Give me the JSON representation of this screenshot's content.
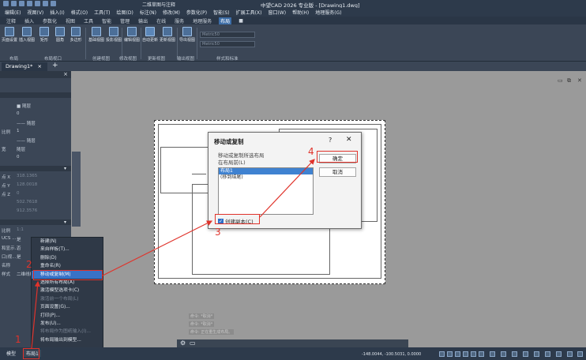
{
  "titlebar": {
    "title": "中望CAD 2026 专业版 - [Drawing1.dwg]",
    "workspace": "二维草图与注释"
  },
  "menu": [
    "编辑(E)",
    "视图(V)",
    "插入(I)",
    "格式(O)",
    "工具(T)",
    "绘图(D)",
    "标注(N)",
    "修改(M)",
    "参数化(P)",
    "智能(S)",
    "扩展工具(X)",
    "窗口(W)",
    "帮助(H)",
    "地理服务(G)"
  ],
  "ribbon_tabs": {
    "items": [
      "注释",
      "插入",
      "参数化",
      "视图",
      "工具",
      "智能",
      "管理",
      "输出",
      "在线",
      "服务",
      "地理服务",
      "布局"
    ],
    "active_index": 11
  },
  "ribbon": {
    "buttons": [
      "页面设置",
      "插入视图",
      "矩形",
      "圆角",
      "多边形",
      "基础视图",
      "投影视图",
      "截面视图",
      "局部视图",
      "编辑视图",
      "自动更新",
      "更新视图",
      "导出视图"
    ],
    "groups": [
      "布局",
      "布局视口",
      "创建视图",
      "修改视图",
      "更新视图",
      "输出视图",
      "样式和标准"
    ],
    "combo1": "Metric50",
    "combo2": "Metric50"
  },
  "doc": {
    "tab": "Drawing1*",
    "close": "×",
    "plus": "+"
  },
  "properties": {
    "rows": [
      {
        "k": "",
        "v": "■ 随层"
      },
      {
        "k": "",
        "v": "0"
      },
      {
        "k": "",
        "v": "—— 随层"
      },
      {
        "k": "比例",
        "v": "1"
      },
      {
        "k": "",
        "v": "—— 随层"
      },
      {
        "k": "宽",
        "v": "随层"
      },
      {
        "k": "",
        "v": "0"
      }
    ],
    "geom": [
      {
        "k": "点 X",
        "v": "318.1365"
      },
      {
        "k": "点 Y",
        "v": "128.0018"
      },
      {
        "k": "点 Z",
        "v": "0"
      },
      {
        "k": "",
        "v": "502.7618"
      },
      {
        "k": "",
        "v": "912.3576"
      }
    ],
    "misc": [
      {
        "k": "比例",
        "v": "1:1"
      },
      {
        "k": "UCS ...",
        "v": "是"
      },
      {
        "k": "和显示...",
        "v": "否"
      },
      {
        "k": "口(视...",
        "v": "是"
      },
      {
        "k": "名称",
        "v": ""
      },
      {
        "k": "样式",
        "v": "二维线框"
      }
    ]
  },
  "dialog": {
    "title": "移动或复制",
    "help": "?",
    "close": "✕",
    "prompt_line1": "移动或复制所选布局",
    "prompt_line2": "在布局前(L)",
    "list_items": [
      "布局1",
      "(移到结尾)"
    ],
    "selected_index": 0,
    "ok_label": "确定",
    "cancel_label": "取消",
    "checkbox_label": "创建副本(C)",
    "checkbox_checked": true
  },
  "context_menu": {
    "items": [
      {
        "label": "新建(N)",
        "state": "normal"
      },
      {
        "label": "来自样板(T)...",
        "state": "normal"
      },
      {
        "label": "删除(D)",
        "state": "normal"
      },
      {
        "label": "重命名(R)",
        "state": "normal"
      },
      {
        "label": "移动或复制(M)",
        "state": "highlight"
      },
      {
        "label": "选择所有布局(A)",
        "state": "normal"
      },
      {
        "label": "激活模型选项卡(C)",
        "state": "normal"
      },
      {
        "label": "激活前一个布局(L)",
        "state": "disabled"
      },
      {
        "label": "页面设置(G)...",
        "state": "normal"
      },
      {
        "label": "打印(P)...",
        "state": "normal"
      },
      {
        "label": "发布(U)...",
        "state": "normal"
      },
      {
        "label": "将布局作为图纸输入(I)...",
        "state": "disabled"
      },
      {
        "label": "将布局输出到模型...",
        "state": "normal"
      }
    ]
  },
  "layout_tabs": {
    "model": "模型",
    "layout": "布局1"
  },
  "annotations": [
    "1",
    "2",
    "3",
    "4"
  ],
  "status": {
    "coords": "-148.0044, -100.5031, 0.0000"
  },
  "ghost_lines": [
    "命令: *取消*",
    "命令: *取消*",
    "命令: 正在重生成布局。"
  ],
  "colors": {
    "chrome": "#2d3a4b",
    "ribbon": "#3b4656",
    "highlight": "#3872c7",
    "annotation": "#e0332b"
  }
}
